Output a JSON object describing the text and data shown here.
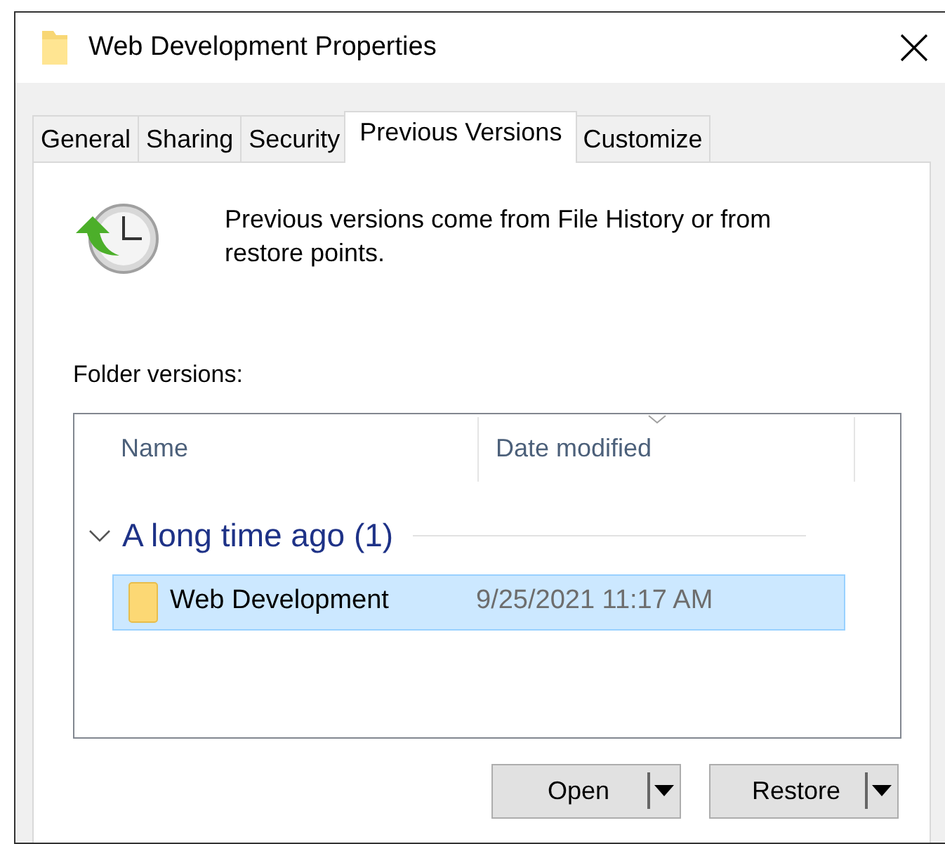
{
  "window": {
    "title": "Web Development Properties"
  },
  "tabs": [
    {
      "label": "General",
      "selected": false
    },
    {
      "label": "Sharing",
      "selected": false
    },
    {
      "label": "Security",
      "selected": false
    },
    {
      "label": "Previous Versions",
      "selected": true
    },
    {
      "label": "Customize",
      "selected": false
    }
  ],
  "description": "Previous versions come from File History or from restore points.",
  "list_label": "Folder versions:",
  "list": {
    "columns": [
      "Name",
      "Date modified"
    ],
    "groups": [
      {
        "title": "A long time ago (1)",
        "expanded": true,
        "rows": [
          {
            "name": "Web Development",
            "date": "9/25/2021 11:17 AM",
            "selected": true
          }
        ]
      }
    ]
  },
  "buttons": [
    "Open",
    "Restore"
  ]
}
